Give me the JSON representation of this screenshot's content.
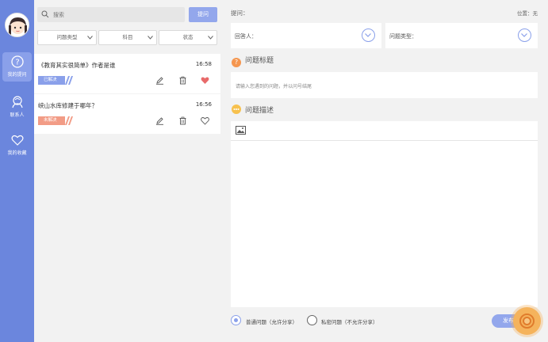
{
  "sidebar": {
    "items": [
      {
        "label": "我的提问",
        "icon": "question-icon",
        "active": true
      },
      {
        "label": "联系人",
        "icon": "contacts-icon",
        "active": false
      },
      {
        "label": "我的收藏",
        "icon": "heart-icon",
        "active": false
      }
    ]
  },
  "list": {
    "search_placeholder": "搜索",
    "ask_label": "提问",
    "filters": [
      "问题类型",
      "科目",
      "状态"
    ],
    "questions": [
      {
        "title": "《教育其实很简单》作者是谁",
        "time": "16:58",
        "status": "已解决",
        "status_color": "#8aa0ea",
        "favorited": true
      },
      {
        "title": "峡山水库修建于哪年？",
        "time": "16:56",
        "status": "未解决",
        "status_color": "#f29c86",
        "favorited": false
      }
    ]
  },
  "form": {
    "ask_label": "提问：",
    "position_label": "位置：无",
    "answerer_label": "回答人：",
    "question_type_label": "问题类型：",
    "title_section": "问题标题",
    "title_placeholder": "请输入您遇到的问题，并以问号结尾",
    "desc_section": "问题描述",
    "radio_public": "普通问题（允许分享）",
    "radio_private": "私密问题（不允许分享）",
    "publish_label": "发布",
    "accent": "#8aa0ea",
    "orange": "#f5964f",
    "yellow": "#f7c14e"
  }
}
